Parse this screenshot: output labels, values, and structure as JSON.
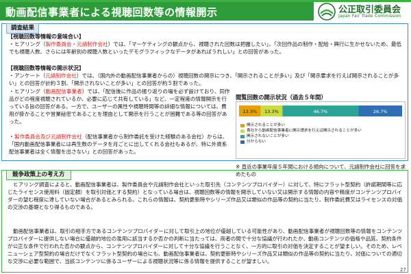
{
  "header": {
    "title": "動画配信事業者による視聴回数等の情報開示",
    "org_name_jp": "公正取引委員会",
    "org_name_en": "Japan Fair Trade Commission"
  },
  "survey": {
    "label": "調査結果",
    "section1_heading": "【視聴回数等情報の意味合い】",
    "section1_p1_pre": "ヒアリング（",
    "section1_p1_red": "製作委員会・元請制作会社",
    "section1_p1_post": "）では、「マーケティングの観点から、視聴された回数は把握したい」、「次回作品の制作・配給・興行に生かせないため、最低でも視聴人数、さらには年齢別の視聴人数といったデモグラフィックなデータがあればうれしい」との回答があった。",
    "section2_heading": "【視聴回数等情報の開示状況】",
    "section2_p1_pre": "アンケート（",
    "section2_p1_red": "元請制作会社",
    "section2_p1_post": "）では、（国内外の動画配信事業者からの）視聴回数の開示につき、「開示されることが多い」及び「開示要求を行えば開示されることが多い」との回答が計約３割、「開示されないことが多い」との回答が約５割であった。",
    "section2_p2_pre": "ヒアリング（",
    "section2_p2_red": "動画配信事業者",
    "section2_p2_post": "）では、「配信後に作品の振り返りの場を必ず設けており、同作品がどの程度視聴されているか、必要に応じて共有している」など、一定程度の情報開示を行っている旨の回答がある。一方で、ユーザーの属性や視聴時間等の詳細な情報については、費用が掛かることや営業秘密であることを理由として開示を行うことが困難である等の回答があった。",
    "section2_p3_pre": "",
    "section2_p3_red": "製作委員会及び元請制作会社",
    "section2_p3_post": "（配信事業者から制作委託を受けた経験のある会社）からは、「国内動画配信事業者には再生数のデータを月ごとに出してくれる会社もあるが、特に外資系配信事業者は全く情報を出さない」との回答があった。"
  },
  "chart_data": {
    "type": "bar",
    "title": "閲覧回数の開示状況（過去５年間）",
    "categories": [
      ""
    ],
    "series": [
      {
        "name": "開示されることが多い",
        "values": [
          13.3
        ],
        "color": "#e8a000"
      },
      {
        "name": "貴社から動画配信事業者に開示請求を行えば開示されることが多い",
        "values": [
          13.3
        ],
        "color": "#c9dd3c"
      },
      {
        "name": "開示されないことが多い",
        "values": [
          46.7
        ],
        "color": "#2ba59a"
      },
      {
        "name": "分からない",
        "values": [
          26.7
        ],
        "color": "#2f6fb3"
      }
    ],
    "value_labels": [
      "13.3%",
      "13.3%",
      "46.7%",
      "26.7%"
    ],
    "ylim": [
      0,
      100
    ],
    "stacked": true,
    "orientation": "horizontal",
    "legend_position": "bottom-left"
  },
  "chart_note": "※ 直近の事業年度５年間における傾向について、元請制作会社に回答を求めたもの",
  "policy": {
    "label": "競争政策上の考え方",
    "p1": "ヒアリング調査によると、動画配信事業者は、製作委員会や元請制作会社といった取引先（コンテンツプロバイダー）に対して、特にフラット型契約（許諾期間等に応じたライセンス使用料（固定額）を取引対価とする契約）となっている場合は、視聴回数等の情報を開示していない又は開示する情報の内容や精度がコンテンツプロバイダーの望む程度に達していない場合があるとみられる。これらの情報は、契約更新時やシリーズ作品又は類似の作品等の契約に当たり、制作委託費又はライセンスの対価の交渉の基礎となり得るものである。",
    "p2": "動画配信事業者は、取引の相手方であるコンテンツプロバイダーに対して取引上の地位が優越している可能性があり、動画配信事業者が視聴回数等の情報をコンテンツプロバイダーに提供しない場合に優越的地位の濫用に該当するか否かの判断に当たっては、両者の間で十分な協議が行われたか、動画コンテンツの価格や品質、契約条件が公正な条件で行われた否かの観点から、コンテンツプロバイダーに対して十分な協議を行うことなく、一方的に取引の対価を決定することが望ましい。そのため、レベニューシェア型契約の場合だけでなくフラット型契約の場合にも、動画配信事業者は、契約更新時やシリーズ作品又は類似の作品等の契約に当たり、対価についての適切な交渉に必要な範囲で、当該コンテンツに係るユーザーによる視聴状況等に係る情報を提供することが望ましい。"
  },
  "page_number": "27"
}
